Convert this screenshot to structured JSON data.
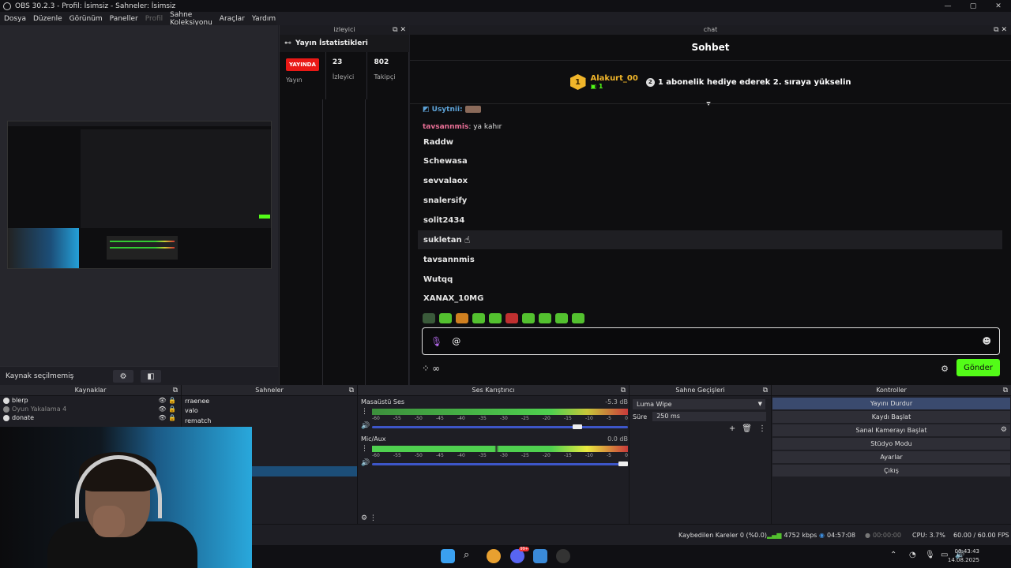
{
  "window": {
    "title": "OBS 30.2.3 - Profil: İsimsiz - Sahneler: İsimsiz",
    "controls": [
      "—",
      "▢",
      "✕"
    ]
  },
  "menu": [
    "Dosya",
    "Düzenle",
    "Görünüm",
    "Paneller",
    "Profil",
    "Sahne Koleksiyonu",
    "Araçlar",
    "Yardım"
  ],
  "source_status": "Kaynak seçilmemiş",
  "viewers_dock": {
    "title": "izleyici",
    "stats_title": "Yayın İstatistikleri",
    "live_badge": "YAYINDA",
    "stream_label": "Yayın",
    "viewers_value": "23",
    "viewers_label": "İzleyici",
    "followers_value": "802",
    "followers_label": "Takipçi"
  },
  "chat": {
    "dock_title": "chat",
    "header": "Sohbet",
    "gifter": {
      "rank": "1",
      "name": "Alakurt_00",
      "count": "1"
    },
    "gift_rank_icon": "2",
    "gift_message": "1 abonelik hediye ederek 2. sıraya yükselin",
    "partial_user": "Usytnii:",
    "top_message_user": "tavsannmis",
    "top_message_text": ": ya kahır",
    "mention_suggestions": [
      "Raddw",
      "Schewasa",
      "sevvalaox",
      "snalersify",
      "solit2434",
      "sukletan",
      "tavsannmis",
      "Wutqq",
      "XANAX_10MG"
    ],
    "input_value": "@",
    "send_label": "Gönder",
    "footer_icons": [
      "dots-icon",
      "infinity-icon"
    ],
    "accent_color": "#53fc18"
  },
  "docks": {
    "sources": {
      "title": "Kaynaklar",
      "items": [
        {
          "name": "blerp",
          "dim": false
        },
        {
          "name": "Oyun Yakalama 4",
          "dim": true
        },
        {
          "name": "donate",
          "dim": false
        }
      ]
    },
    "scenes": {
      "title": "Sahneler",
      "items": [
        "rraenee",
        "valo",
        "rematch"
      ]
    },
    "mixer": {
      "title": "Ses Karıştırıcı",
      "channels": [
        {
          "name": "Masaüstü Ses",
          "db": "-5.3 dB",
          "volume": 0.82
        },
        {
          "name": "Mic/Aux",
          "db": "0.0 dB",
          "volume": 1.0
        }
      ],
      "ticks": [
        "-60",
        "-55",
        "-50",
        "-45",
        "-40",
        "-35",
        "-30",
        "-25",
        "-20",
        "-15",
        "-10",
        "-5",
        "0"
      ]
    },
    "transitions": {
      "title": "Sahne Geçişleri",
      "selected": "Luma Wipe",
      "duration_label": "Süre",
      "duration_value": "250 ms"
    },
    "controls": {
      "title": "Kontroller",
      "buttons": [
        "Yayını Durdur",
        "Kaydı Başlat",
        "Sanal Kamerayı Başlat",
        "Stüdyo Modu",
        "Ayarlar",
        "Çıkış"
      ]
    }
  },
  "status": {
    "dropped_frames": "Kaybedilen Kareler 0 (%0.0)",
    "bitrate": "4752 kbps",
    "stream_time": "04:57:08",
    "rec_time": "00:00:00",
    "cpu": "CPU: 3.7%",
    "fps": "60.00 / 60.00 FPS"
  },
  "taskbar": {
    "time": "00:43:43",
    "date": "14.08.2025",
    "discord_badge": "99+"
  }
}
